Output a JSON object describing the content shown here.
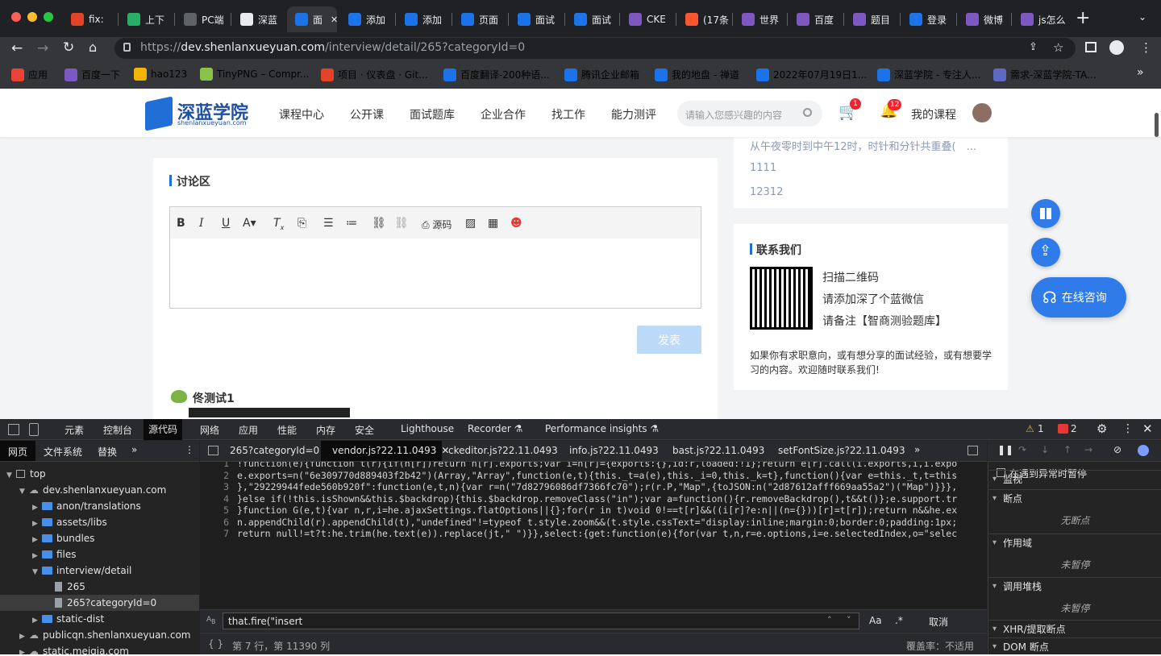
{
  "tabs": [
    {
      "label": "fix:",
      "color": "#e24329"
    },
    {
      "label": "上下",
      "color": "#2aae67"
    },
    {
      "label": "PC端",
      "color": "#5f6368"
    },
    {
      "label": "深蓝",
      "color": "#e8eaed"
    },
    {
      "label": "面",
      "color": "#1a73e8"
    },
    {
      "label": "添加",
      "color": "#1a73e8"
    },
    {
      "label": "添加",
      "color": "#1a73e8"
    },
    {
      "label": "页面",
      "color": "#1a73e8"
    },
    {
      "label": "面试",
      "color": "#1a73e8"
    },
    {
      "label": "面试",
      "color": "#1a73e8"
    },
    {
      "label": "CKE",
      "color": "#7e57c2"
    },
    {
      "label": "(17条",
      "color": "#fc5531"
    },
    {
      "label": "世界",
      "color": "#7e57c2"
    },
    {
      "label": "百度",
      "color": "#7e57c2"
    },
    {
      "label": "题目",
      "color": "#7e57c2"
    },
    {
      "label": "登录",
      "color": "#1a73e8"
    },
    {
      "label": "微博",
      "color": "#7e57c2"
    },
    {
      "label": "js怎么",
      "color": "#7e57c2"
    }
  ],
  "address": {
    "scheme": "https://",
    "host": "dev.shenlanxueyuan.com",
    "path": "/interview/detail/265?categoryId=0"
  },
  "bookmarks": [
    {
      "label": "应用",
      "color": "#ea4335"
    },
    {
      "label": "百度一下",
      "color": "#7e57c2"
    },
    {
      "label": "hao123",
      "color": "#f4b400"
    },
    {
      "label": "TinyPNG – Compr...",
      "color": "#8bc34a"
    },
    {
      "label": "项目 · 仪表盘 · Git...",
      "color": "#e24329"
    },
    {
      "label": "百度翻译-200种语...",
      "color": "#1a73e8"
    },
    {
      "label": "腾讯企业邮箱",
      "color": "#1a73e8"
    },
    {
      "label": "我的地盘 - 禅道",
      "color": "#1a73e8"
    },
    {
      "label": "2022年07月19日1...",
      "color": "#1a73e8"
    },
    {
      "label": "深蓝学院 - 专注人...",
      "color": "#1a73e8"
    },
    {
      "label": "需求-深蓝学院-TA...",
      "color": "#5c6bc0"
    }
  ],
  "site": {
    "logo_cn": "深蓝学院",
    "logo_en": "shenlanxueyuan.com",
    "nav": [
      "课程中心",
      "公开课",
      "面试题库",
      "企业合作",
      "找工作",
      "能力测评"
    ],
    "search_placeholder": "请输入您感兴趣的内容",
    "cart_count": "1",
    "notice_count": "12",
    "my_courses": "我的课程"
  },
  "discussion": {
    "title": "讨论区",
    "source_label": "源码",
    "publish_button": "发表",
    "comment_author": "佟测试1"
  },
  "related": [
    "从午夜零时到中午12时，时针和分针共重叠(　...",
    "1111",
    "12312"
  ],
  "contact": {
    "title": "联系我们",
    "lines": [
      "扫描二维码",
      "请添加深了个蓝微信",
      "请备注【智商测验题库】"
    ],
    "desc": "如果你有求职意向，或有想分享的面试经验，或有想要学习的内容。欢迎随时联系我们!"
  },
  "consult_button": "在线咨询",
  "devtools": {
    "tabs": [
      "元素",
      "控制台",
      "源代码",
      "网络",
      "应用",
      "性能",
      "内存",
      "安全",
      "Lighthouse",
      "Recorder ⚗",
      "Performance insights ⚗"
    ],
    "warn_count": "1",
    "error_count": "2",
    "nav_tabs": [
      "网页",
      "文件系统",
      "替换"
    ],
    "files": [
      "265?categoryId=0",
      "vendor.js?22.11.0493",
      "ckeditor.js?22.11.0493",
      "info.js?22.11.0493",
      "bast.js?22.11.0493",
      "setFontSize.js?22.11.0493"
    ],
    "tree": [
      {
        "label": "top",
        "type": "frame",
        "depth": 0
      },
      {
        "label": "dev.shenlanxueyuan.com",
        "type": "cloud",
        "depth": 1
      },
      {
        "label": "anon/translations",
        "type": "folder",
        "depth": 2
      },
      {
        "label": "assets/libs",
        "type": "folder",
        "depth": 2
      },
      {
        "label": "bundles",
        "type": "folder",
        "depth": 2
      },
      {
        "label": "files",
        "type": "folder",
        "depth": 2
      },
      {
        "label": "interview/detail",
        "type": "folder",
        "depth": 2
      },
      {
        "label": "265",
        "type": "file",
        "depth": 3
      },
      {
        "label": "265?categoryId=0",
        "type": "file",
        "depth": 3
      },
      {
        "label": "static-dist",
        "type": "folder",
        "depth": 2
      },
      {
        "label": "publicqn.shenlanxueyuan.com",
        "type": "cloud",
        "depth": 1
      },
      {
        "label": "static.meiqia.com",
        "type": "cloud",
        "depth": 1
      }
    ],
    "code_lines": [
      "!function(e){function t(r){if(n[r])return n[r].exports;var i=n[r]={exports:{},id:r,loaded:!1};return e[r].call(i.exports,i,i.expo",
      "e.exports=n(\"6e309770d889403f2b42\")(Array,\"Array\",function(e,t){this._t=a(e),this._i=0,this._k=t},function(){var e=this._t,t=this",
      "},\"29229944fede560b920f\":function(e,t,n){var r=n(\"7d82796086df7366fc70\");r(r.P,\"Map\",{toJSON:n(\"2d87612afff669aa55a2\")(\"Map\")}}},",
      "}else if(!this.isShown&&this.$backdrop){this.$backdrop.removeClass(\"in\");var a=function(){r.removeBackdrop(),t&&t()};e.support.tr",
      "}function G(e,t){var n,r,i=he.ajaxSettings.flatOptions||{};for(r in t)void 0!==t[r]&&((i[r]?e:n||(n={}))[r]=t[r]);return n&&he.ex",
      "n.appendChild(r).appendChild(t),\"undefined\"!=typeof t.style.zoom&&(t.style.cssText=\"display:inline;margin:0;border:0;padding:1px;",
      "return null!=t?t:he.trim(he.text(e)).replace(jt,\" \")}},select:{get:function(e){for(var t,n,r=e.options,i=e.selectedIndex,o=\"selec"
    ],
    "search_text": "that.fire(\"insert",
    "search_case": "Aa",
    "search_regex": ".*",
    "cancel": "取消",
    "status": "第 7 行，第 11390 列",
    "coverage": "覆盖率：不适用",
    "pause_on_exception": "在遇到异常时暂停",
    "sections": [
      {
        "title": "监视",
        "empty": ""
      },
      {
        "title": "断点",
        "empty": "无断点"
      },
      {
        "title": "作用域",
        "empty": "未暂停"
      },
      {
        "title": "调用堆栈",
        "empty": "未暂停"
      },
      {
        "title": "XHR/提取断点",
        "empty": ""
      },
      {
        "title": "DOM 断点",
        "empty": ""
      }
    ]
  },
  "colors": {
    "accent": "#1f6fd6",
    "publish_disabled": "#bcd9f7",
    "devtools_bg": "#242424"
  }
}
